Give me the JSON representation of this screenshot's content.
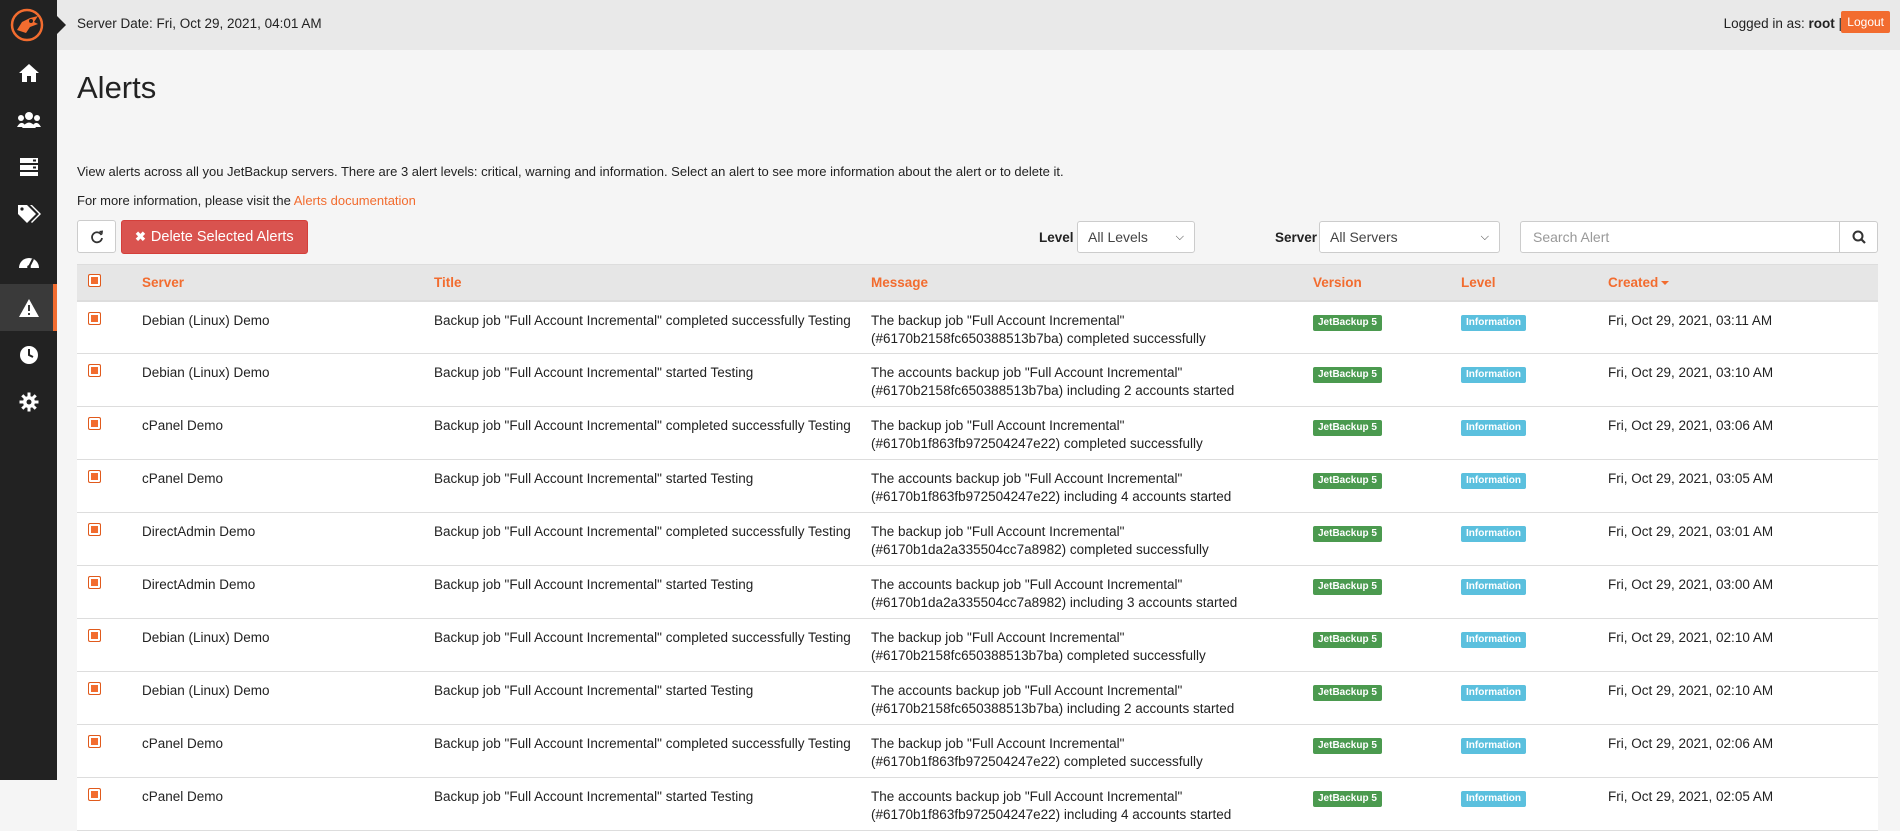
{
  "header": {
    "server_date_label": "Server Date: Fri, Oct 29, 2021, 04:01 AM",
    "logged_in_prefix": "Logged in as:",
    "username": "root",
    "separator": "|",
    "logout_label": "Logout"
  },
  "sidebar": {
    "items": [
      {
        "name": "home-icon"
      },
      {
        "name": "users-icon"
      },
      {
        "name": "servers-icon"
      },
      {
        "name": "tags-icon"
      },
      {
        "name": "dashboard-icon"
      },
      {
        "name": "alerts-icon",
        "active": true
      },
      {
        "name": "clock-icon"
      },
      {
        "name": "gear-icon"
      }
    ]
  },
  "page": {
    "title": "Alerts",
    "description": "View alerts across all you JetBackup servers. There are 3 alert levels: critical, warning and information. Select an alert to see more information about the alert or to delete it.",
    "more_info_prefix": "For more information, please visit the ",
    "more_info_link": "Alerts documentation"
  },
  "toolbar": {
    "delete_label": "Delete Selected Alerts",
    "level_label": "Level",
    "level_value": "All Levels",
    "server_label": "Server",
    "server_value": "All Servers",
    "search_placeholder": "Search Alert"
  },
  "table": {
    "columns": [
      "Server",
      "Title",
      "Message",
      "Version",
      "Level",
      "Created"
    ],
    "rows": [
      {
        "server": "Debian (Linux) Demo",
        "title": "Backup job \"Full Account Incremental\" completed successfully Testing",
        "message1": "The backup job \"Full Account Incremental\"",
        "message2": "(#6170b2158fc650388513b7ba) completed successfully",
        "version": "JetBackup 5",
        "level": "Information",
        "created": "Fri, Oct 29, 2021, 03:11 AM"
      },
      {
        "server": "Debian (Linux) Demo",
        "title": "Backup job \"Full Account Incremental\" started Testing",
        "message1": "The accounts backup job \"Full Account Incremental\"",
        "message2": "(#6170b2158fc650388513b7ba) including 2 accounts started",
        "version": "JetBackup 5",
        "level": "Information",
        "created": "Fri, Oct 29, 2021, 03:10 AM"
      },
      {
        "server": "cPanel Demo",
        "title": "Backup job \"Full Account Incremental\" completed successfully Testing",
        "message1": "The backup job \"Full Account Incremental\"",
        "message2": "(#6170b1f863fb972504247e22) completed successfully",
        "version": "JetBackup 5",
        "level": "Information",
        "created": "Fri, Oct 29, 2021, 03:06 AM"
      },
      {
        "server": "cPanel Demo",
        "title": "Backup job \"Full Account Incremental\" started Testing",
        "message1": "The accounts backup job \"Full Account Incremental\"",
        "message2": "(#6170b1f863fb972504247e22) including 4 accounts started",
        "version": "JetBackup 5",
        "level": "Information",
        "created": "Fri, Oct 29, 2021, 03:05 AM"
      },
      {
        "server": "DirectAdmin Demo",
        "title": "Backup job \"Full Account Incremental\" completed successfully Testing",
        "message1": "The backup job \"Full Account Incremental\"",
        "message2": "(#6170b1da2a335504cc7a8982) completed successfully",
        "version": "JetBackup 5",
        "level": "Information",
        "created": "Fri, Oct 29, 2021, 03:01 AM"
      },
      {
        "server": "DirectAdmin Demo",
        "title": "Backup job \"Full Account Incremental\" started Testing",
        "message1": "The accounts backup job \"Full Account Incremental\"",
        "message2": "(#6170b1da2a335504cc7a8982) including 3 accounts started",
        "version": "JetBackup 5",
        "level": "Information",
        "created": "Fri, Oct 29, 2021, 03:00 AM"
      },
      {
        "server": "Debian (Linux) Demo",
        "title": "Backup job \"Full Account Incremental\" completed successfully Testing",
        "message1": "The backup job \"Full Account Incremental\"",
        "message2": "(#6170b2158fc650388513b7ba) completed successfully",
        "version": "JetBackup 5",
        "level": "Information",
        "created": "Fri, Oct 29, 2021, 02:10 AM"
      },
      {
        "server": "Debian (Linux) Demo",
        "title": "Backup job \"Full Account Incremental\" started Testing",
        "message1": "The accounts backup job \"Full Account Incremental\"",
        "message2": "(#6170b2158fc650388513b7ba) including 2 accounts started",
        "version": "JetBackup 5",
        "level": "Information",
        "created": "Fri, Oct 29, 2021, 02:10 AM"
      },
      {
        "server": "cPanel Demo",
        "title": "Backup job \"Full Account Incremental\" completed successfully Testing",
        "message1": "The backup job \"Full Account Incremental\"",
        "message2": "(#6170b1f863fb972504247e22) completed successfully",
        "version": "JetBackup 5",
        "level": "Information",
        "created": "Fri, Oct 29, 2021, 02:06 AM"
      },
      {
        "server": "cPanel Demo",
        "title": "Backup job \"Full Account Incremental\" started Testing",
        "message1": "The accounts backup job \"Full Account Incremental\"",
        "message2": "(#6170b1f863fb972504247e22) including 4 accounts started",
        "version": "JetBackup 5",
        "level": "Information",
        "created": "Fri, Oct 29, 2021, 02:05 AM"
      }
    ]
  },
  "colors": {
    "accent": "#f26c2f",
    "danger": "#d9534f",
    "version_badge": "#4b9a4f",
    "level_badge": "#5bc0de",
    "sidebar_bg": "#222222"
  }
}
